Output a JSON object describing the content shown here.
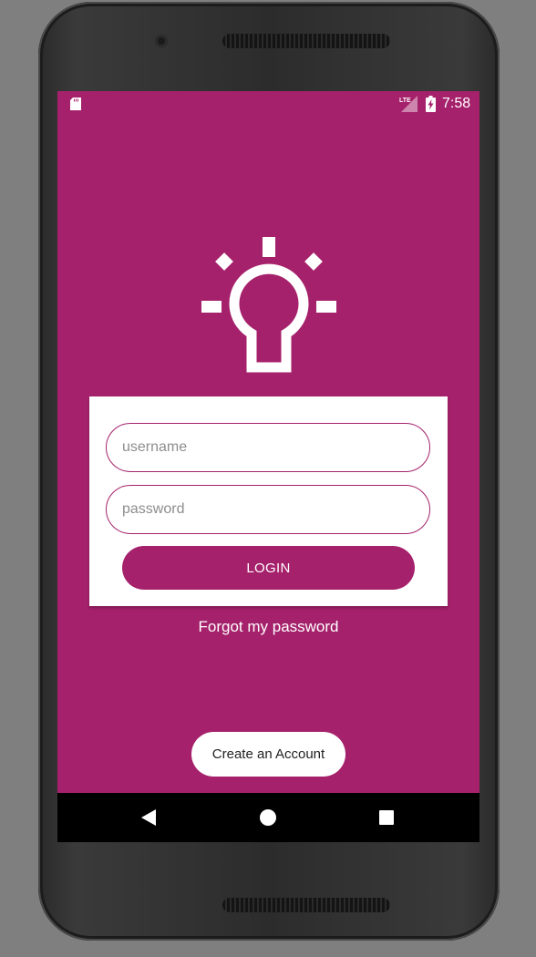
{
  "status_bar": {
    "time": "7:58",
    "network_label": "LTE",
    "icons": [
      "sd-card-icon",
      "lte-signal-icon",
      "battery-charging-icon"
    ]
  },
  "app": {
    "logo_icon": "lightbulb-icon",
    "accent_color": "#a5216b",
    "username_placeholder": "username",
    "password_placeholder": "password",
    "username_value": "",
    "password_value": "",
    "login_label": "LOGIN",
    "forgot_label": "Forgot my password",
    "create_account_label": "Create an Account"
  },
  "nav_bar": {
    "icons": [
      "back-icon",
      "home-icon",
      "recents-icon"
    ]
  }
}
